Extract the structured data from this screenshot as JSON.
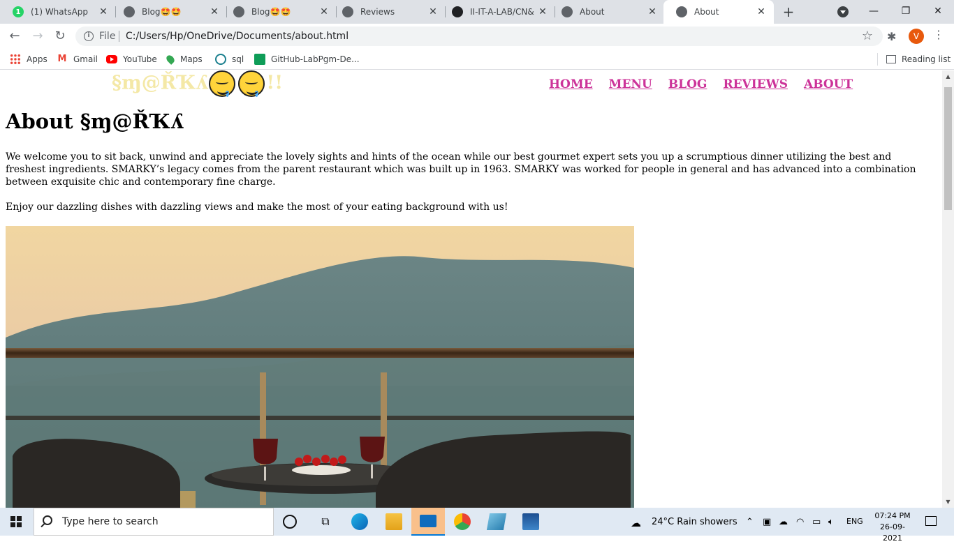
{
  "browser": {
    "tabs": [
      {
        "label": "(1) WhatsApp",
        "icon": "whatsapp-icon"
      },
      {
        "label": "Blog🤩🤩",
        "icon": "globe-icon"
      },
      {
        "label": "Blog🤩🤩",
        "icon": "globe-icon"
      },
      {
        "label": "Reviews",
        "icon": "globe-icon"
      },
      {
        "label": "II-IT-A-LAB/CN&",
        "icon": "github-icon"
      },
      {
        "label": "About",
        "icon": "globe-icon"
      },
      {
        "label": "About",
        "icon": "globe-icon"
      }
    ],
    "active_tab_index": 6,
    "address": {
      "scheme": "File",
      "url": "C:/Users/Hp/OneDrive/Documents/about.html"
    },
    "profile_initial": "V",
    "bookmarks": [
      {
        "label": "Apps",
        "icon": "apps-grid-icon"
      },
      {
        "label": "Gmail",
        "icon": "gmail-icon"
      },
      {
        "label": "YouTube",
        "icon": "youtube-icon"
      },
      {
        "label": "Maps",
        "icon": "maps-pin-icon"
      },
      {
        "label": "sql",
        "icon": "sql-icon"
      },
      {
        "label": "GitHub-LabPgm-De...",
        "icon": "sheets-icon"
      }
    ],
    "reading_list": "Reading list",
    "accent_color": "#e8590c"
  },
  "page": {
    "brand": "§ɱ@ŘҠʎ",
    "brand_suffix": "!!",
    "brand_color": "#f4e8a6",
    "nav": [
      "HOME",
      "MENU",
      "BLOG",
      "REVIEWS",
      "ABOUT"
    ],
    "nav_color": "#cc3399",
    "heading": "About §ɱ@ŘҠʎ",
    "paragraph1": "We welcome you to sit back, unwind and appreciate the lovely sights and hints of the ocean while our best gourmet expert sets you up a scrumptious dinner utilizing the best and freshest ingredients. SMARKY’s legacy comes from the parent restaurant which was built up in 1963. SMARKY was worked for people in general and has advanced into a combination between exquisite chic and contemporary fine charge.",
    "paragraph2": "Enjoy our dazzling dishes with dazzling views and make the most of your eating background with us!"
  },
  "taskbar": {
    "search_placeholder": "Type here to search",
    "weather": "24°C  Rain showers",
    "language": "ENG",
    "time": "07:24 PM",
    "date": "26-09-2021"
  }
}
